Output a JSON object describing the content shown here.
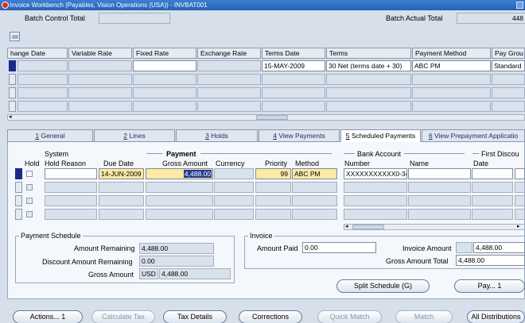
{
  "window": {
    "title": "Invoice Workbench (Payables, Vision Operations (USA)) - INVBAT001"
  },
  "batch": {
    "control_total_label": "Batch Control Total",
    "control_total_value": "",
    "actual_total_label": "Batch Actual Total",
    "actual_total_value": "448"
  },
  "invoice_grid": {
    "columns": [
      "hange Date",
      "Variable Rate",
      "Fixed Rate",
      "Exchange Rate",
      "Terms Date",
      "Terms",
      "Payment Method",
      "Pay Grou"
    ],
    "row1": {
      "terms_date": "15-MAY-2009",
      "terms": "30 Net (terms date + 30)",
      "payment_method": "ABC PM",
      "pay_group": "Standard"
    }
  },
  "tabs": [
    {
      "num": "1",
      "label": "General"
    },
    {
      "num": "2",
      "label": "Lines"
    },
    {
      "num": "3",
      "label": "Holds"
    },
    {
      "num": "4",
      "label": "View Payments"
    },
    {
      "num": "5",
      "label": "Scheduled Payments"
    },
    {
      "num": "6",
      "label": "View Prepayment Applicatio"
    }
  ],
  "schedule_grid": {
    "headers": {
      "system": "System",
      "hold": "Hold",
      "hold_reason": "Hold Reason",
      "due_date": "Due Date",
      "payment": "Payment",
      "gross_amount": "Gross Amount",
      "currency": "Currency",
      "priority": "Priority",
      "method": "Method",
      "bank_account": "Bank Account",
      "number": "Number",
      "name": "Name",
      "first_discount": "First Discou",
      "date": "Date"
    },
    "row1": {
      "due_date": "14-JUN-2009",
      "gross_amount": "4,488.00",
      "priority": "99",
      "method": "ABC PM",
      "bank_number": "XXXXXXXXXXX0-34"
    }
  },
  "payment_schedule": {
    "title": "Payment Schedule",
    "amount_remaining_label": "Amount Remaining",
    "amount_remaining": "4,488.00",
    "discount_remaining_label": "Discount Amount Remaining",
    "discount_remaining": "0.00",
    "gross_amount_label": "Gross Amount",
    "currency": "USD",
    "gross_amount": "4,488.00"
  },
  "invoice": {
    "title": "Invoice",
    "amount_paid_label": "Amount Paid",
    "amount_paid": "0.00",
    "invoice_amount_label": "Invoice Amount",
    "invoice_amount": "4,488.00",
    "gross_total_label": "Gross Amount Total",
    "gross_total": "4,488.00"
  },
  "buttons": {
    "split_schedule": "Split Schedule (G)",
    "pay": "Pay... 1",
    "actions": "Actions... 1",
    "calculate_tax": "Calculate Tax",
    "tax_details": "Tax Details",
    "corrections": "Corrections",
    "quick_match": "Quick Match",
    "match": "Match",
    "all_distributions": "All Distributions"
  },
  "icons": [
    "folder-icon",
    "scroll-left-icon",
    "scroll-right-icon"
  ]
}
